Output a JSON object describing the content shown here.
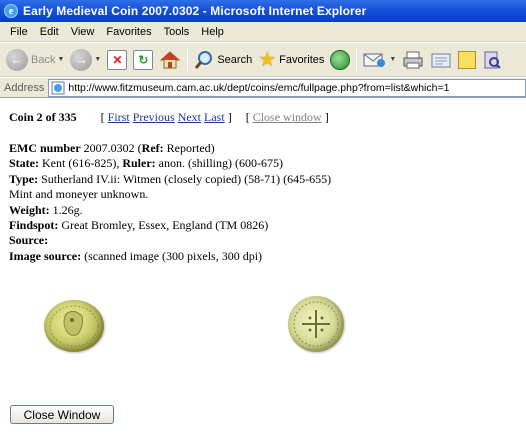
{
  "window": {
    "title": "Early Medieval Coin 2007.0302 - Microsoft Internet Explorer"
  },
  "menu": {
    "items": [
      "File",
      "Edit",
      "View",
      "Favorites",
      "Tools",
      "Help"
    ]
  },
  "toolbar": {
    "back_label": "Back",
    "search_label": "Search",
    "favorites_label": "Favorites"
  },
  "address": {
    "label": "Address",
    "url": "http://www.fitzmuseum.cam.ac.uk/dept/coins/emc/fullpage.php?from=list&which=1"
  },
  "page": {
    "coin_count": "Coin 2 of 335",
    "nav": {
      "open_bracket": "[",
      "first": "First",
      "previous": "Previous",
      "next": "Next",
      "last": "Last",
      "close_bracket": "]"
    },
    "close_window_link": "Close window",
    "details": {
      "emc_label": "EMC number",
      "emc_value": " 2007.0302 (",
      "ref_label": "Ref:",
      "ref_value": " Reported)",
      "state_label": "State:",
      "state_value": " Kent (616-825), ",
      "ruler_label": "Ruler:",
      "ruler_value": " anon. (shilling) (600-675)",
      "type_label": "Type:",
      "type_value": " Sutherland IV.ii: Witmen (closely copied) (58-71) (645-655)",
      "mint_line": "Mint and moneyer unknown.",
      "weight_label": "Weight:",
      "weight_value": " 1.26g.",
      "findspot_label": "Findspot:",
      "findspot_value": " Great Bromley, Essex, England (TM 0826)",
      "source_label": "Source:",
      "source_value": "",
      "image_source_label": "Image source:",
      "image_source_value": " (scanned image (300 pixels, 300 dpi)"
    },
    "close_button": "Close Window"
  }
}
